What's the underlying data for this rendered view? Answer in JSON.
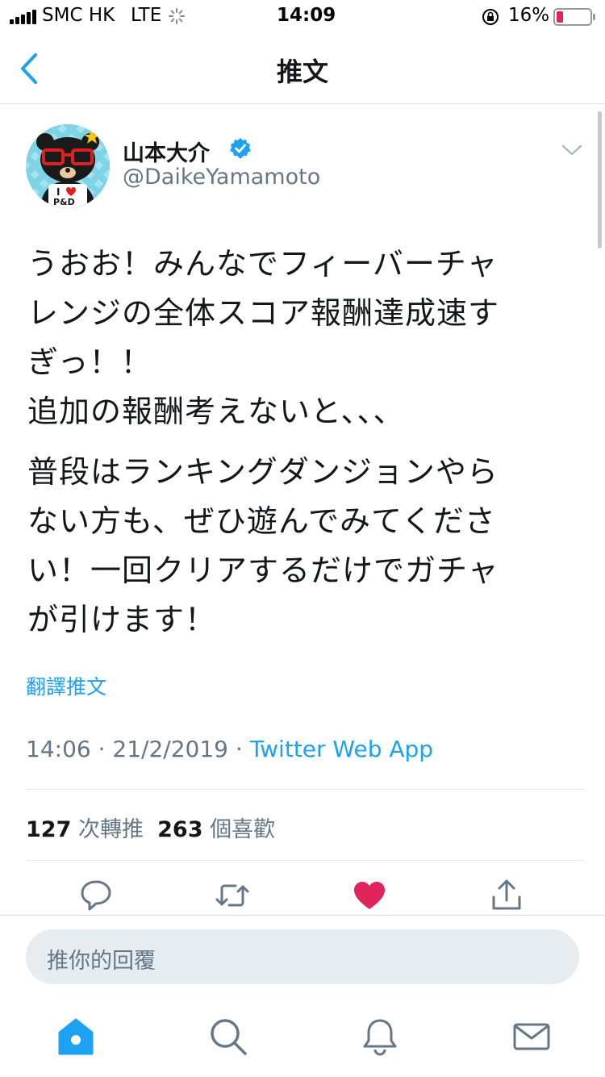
{
  "status_bar": {
    "carrier": "SMC HK",
    "network": "LTE",
    "time": "14:09",
    "battery": "16%"
  },
  "header": {
    "title": "推文"
  },
  "author": {
    "name": "山本大介",
    "handle": "@DaikeYamamoto",
    "avatar_text": [
      "I",
      "P&D"
    ]
  },
  "tweet": {
    "paragraphs": [
      "うおお！みんなでフィーバーチャ\nレンジの全体スコア報酬達成速す\nぎっ！！\n追加の報酬考えないと、、、",
      "普段はランキングダンジョンやら\nない方も、ぜひ遊んでみてくださ\nい！一回クリアするだけでガチャ\nが引けます！"
    ],
    "translate_label": "翻譯推文",
    "time": "14:06",
    "date": "21/2/2019",
    "source": "Twitter Web App"
  },
  "stats": {
    "retweets": "127",
    "retweets_label": "次轉推",
    "likes": "263",
    "likes_label": "個喜歡"
  },
  "reply": {
    "placeholder": "推你的回覆"
  },
  "colors": {
    "accent": "#1da1f2",
    "like": "#e0245e",
    "muted": "#657786",
    "battery_low": "#e0245e"
  },
  "icons": [
    "back-icon",
    "verified-icon",
    "caret-down-icon",
    "reply-icon",
    "retweet-icon",
    "like-icon",
    "share-icon",
    "home-icon",
    "search-icon",
    "notifications-icon",
    "messages-icon"
  ]
}
